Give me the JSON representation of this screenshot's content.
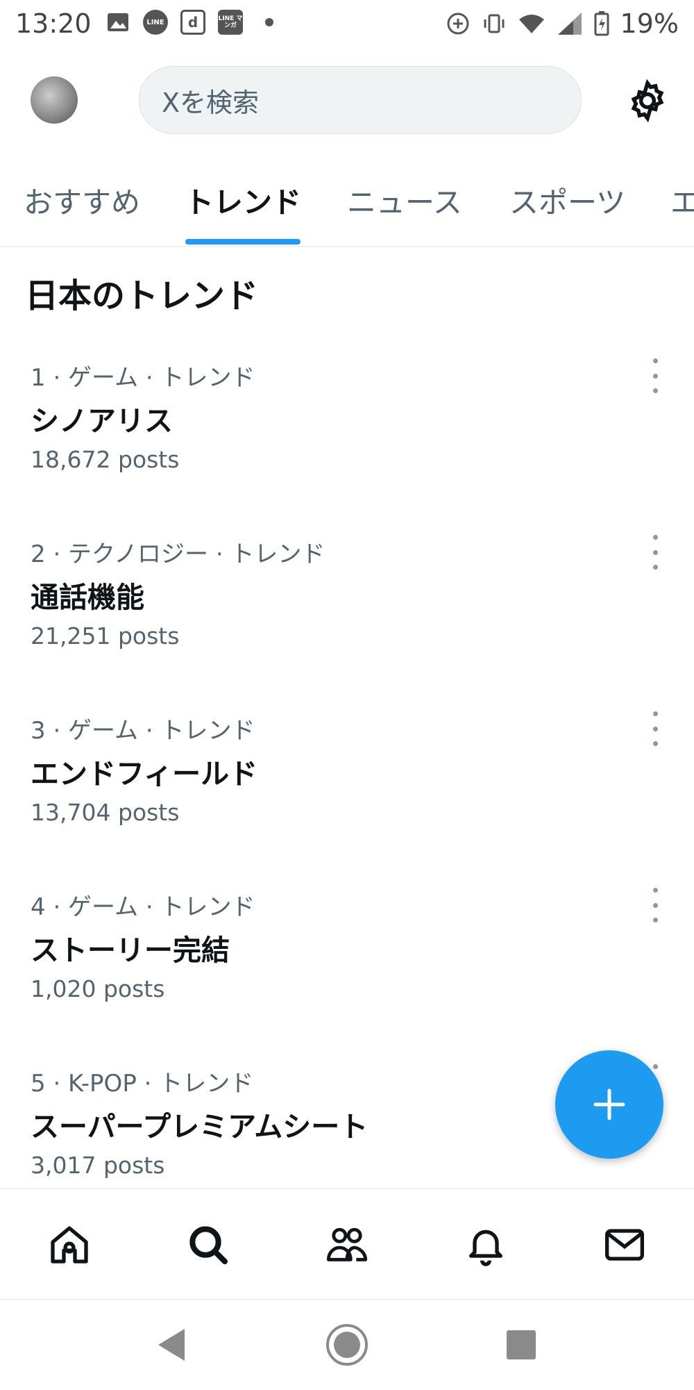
{
  "status_bar": {
    "time": "13:20",
    "battery": "19%",
    "app_icons": [
      "image-icon",
      "line-icon",
      "d-icon",
      "line-manga-icon"
    ],
    "line_label": "LINE",
    "line_manga_label": "LINE マンガ",
    "d_label": "d"
  },
  "header": {
    "search_placeholder": "Xを検索"
  },
  "tabs": [
    {
      "label": "おすすめ"
    },
    {
      "label": "トレンド"
    },
    {
      "label": "ニュース"
    },
    {
      "label": "スポーツ"
    },
    {
      "label": "エ"
    }
  ],
  "section_title": "日本のトレンド",
  "trends": [
    {
      "meta": "1 · ゲーム · トレンド",
      "title": "シノアリス",
      "count": "18,672 posts"
    },
    {
      "meta": "2 · テクノロジー · トレンド",
      "title": "通話機能",
      "count": "21,251 posts"
    },
    {
      "meta": "3 · ゲーム · トレンド",
      "title": "エンドフィールド",
      "count": "13,704 posts"
    },
    {
      "meta": "4 · ゲーム · トレンド",
      "title": "ストーリー完結",
      "count": "1,020 posts"
    },
    {
      "meta": "5 · K-POP · トレンド",
      "title": "スーパープレミアムシート",
      "count": "3,017 posts"
    }
  ],
  "colors": {
    "accent": "#1d9bf0",
    "text_primary": "#0f1419",
    "text_secondary": "#536471"
  }
}
